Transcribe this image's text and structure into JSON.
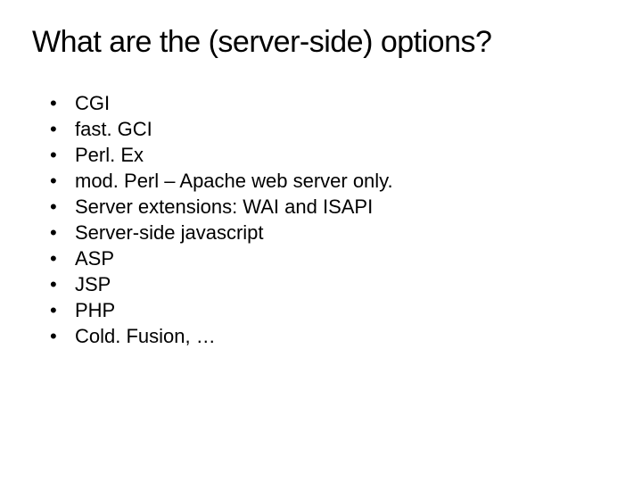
{
  "slide": {
    "title": "What are the (server-side) options?",
    "bullets": [
      "CGI",
      "fast. GCI",
      "Perl. Ex",
      "mod. Perl – Apache web server only.",
      "Server extensions: WAI and ISAPI",
      "Server-side javascript",
      "ASP",
      "JSP",
      "PHP",
      "Cold. Fusion, …"
    ]
  }
}
